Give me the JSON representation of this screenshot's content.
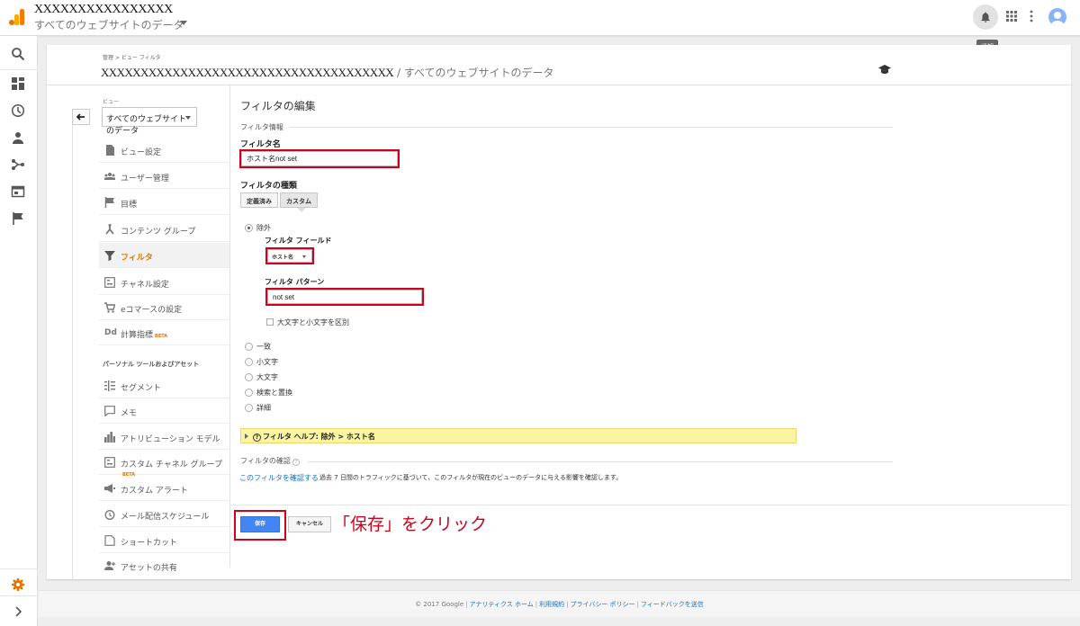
{
  "header": {
    "account_name": "XXXXXXXXXXXXXXXX",
    "view_name": "すべてのウェブサイトのデータ",
    "notification_tooltip": "通知"
  },
  "rail": {
    "icons": [
      "search-icon",
      "customization-icon",
      "realtime-icon",
      "audience-icon",
      "acquisition-icon",
      "behavior-icon",
      "conversions-icon",
      "admin-gear-icon",
      "expand-icon"
    ]
  },
  "card": {
    "breadcrumb": "管理 > ビュー フィルタ",
    "property_name": "XXXXXXXXXXXXXXXXXXXXXXXXXXXXXXXXXXXXX",
    "property_view": " / すべてのウェブサイトのデータ"
  },
  "nav": {
    "view_label": "ビュー",
    "view_select": "すべてのウェブサイトのデータ",
    "items": [
      {
        "label": "ビュー設定",
        "icon": "document-icon"
      },
      {
        "label": "ユーザー管理",
        "icon": "users-icon"
      },
      {
        "label": "目標",
        "icon": "flag-icon"
      },
      {
        "label": "コンテンツ グループ",
        "icon": "content-group-icon"
      },
      {
        "label": "フィルタ",
        "icon": "filter-icon"
      },
      {
        "label": "チャネル設定",
        "icon": "channel-icon"
      },
      {
        "label": "eコマースの設定",
        "icon": "cart-icon"
      },
      {
        "label": "計算指標",
        "icon": "calc-metric-icon",
        "badge": "BETA"
      }
    ],
    "section_heading": "パーソナル ツールおよびアセット",
    "personal_items": [
      {
        "label": "セグメント",
        "icon": "segment-icon"
      },
      {
        "label": "メモ",
        "icon": "note-icon"
      },
      {
        "label": "アトリビューション モデル",
        "icon": "attribution-icon"
      },
      {
        "label": "カスタム チャネル グループ",
        "icon": "custom-channel-icon",
        "badge": "BETA"
      },
      {
        "label": "カスタム アラート",
        "icon": "alert-icon"
      },
      {
        "label": "メール配信スケジュール",
        "icon": "schedule-icon"
      },
      {
        "label": "ショートカット",
        "icon": "shortcut-icon"
      },
      {
        "label": "アセットの共有",
        "icon": "share-icon"
      }
    ]
  },
  "form": {
    "title": "フィルタの編集",
    "section_info": "フィルタ情報",
    "filter_name_label": "フィルタ名",
    "filter_name_value": "ホスト名not set",
    "filter_type_label": "フィルタの種類",
    "type_predefined": "定義済み",
    "type_custom": "カスタム",
    "opt_exclude": "除外",
    "filter_field_label": "フィルタ フィールド",
    "filter_field_value": "ホスト名",
    "filter_pattern_label": "フィルタ パターン",
    "filter_pattern_value": "not set",
    "case_sensitive": "大文字と小文字を区別",
    "opt_match": "一致",
    "opt_lowercase": "小文字",
    "opt_uppercase": "大文字",
    "opt_search_replace": "検索と置換",
    "opt_advanced": "詳細",
    "help_text": "フィルタ ヘルプ: 除外 > ホスト名",
    "verify_heading": "フィルタの確認",
    "verify_link": "このフィルタを確認する",
    "verify_desc": "過去 7 日間のトラフィックに基づいて、このフィルタが現在のビューのデータに与える影響を確認します。",
    "save": "保存",
    "cancel": "キャンセル",
    "annotation": "「保存」をクリック"
  },
  "footer": {
    "copyright": "© 2017 Google",
    "links": [
      "アナリティクス ホーム",
      "利用規約",
      "プライバシー ポリシー",
      "フィードバックを送信"
    ]
  },
  "colors": {
    "accent_orange": "#e37400",
    "save_blue": "#4285f4",
    "link_blue": "#1a6fbf",
    "highlight_red": "#d0021b",
    "help_yellow": "#fbf5a3"
  }
}
